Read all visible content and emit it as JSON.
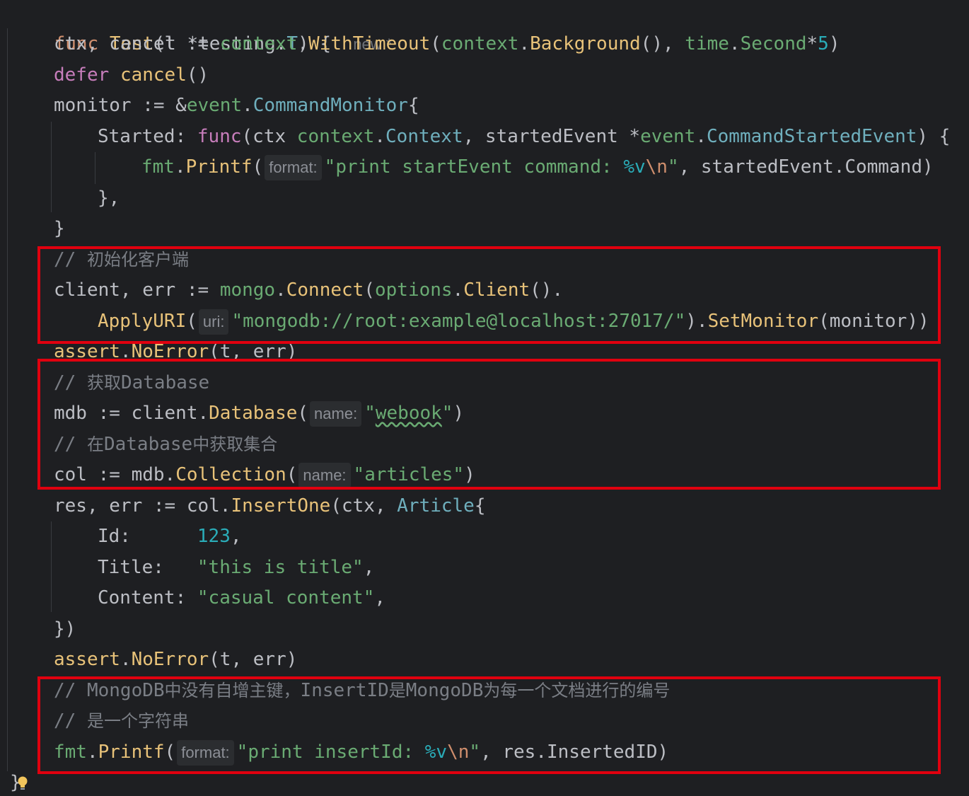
{
  "editor": {
    "language": "Go",
    "colors": {
      "background": "#1e1f22",
      "keyword": "#cf8e6d",
      "function": "#56a8f5",
      "string": "#6aab73",
      "comment": "#7a7e85",
      "highlight_box": "#e0000f"
    },
    "l1": {
      "kw": "func",
      "name": "Test",
      "p1": "(t *testing.",
      "p2": "T",
      "p3": ") {",
      "meta": "new *"
    },
    "l2": {
      "a": "ctx, cancel := ",
      "b": "context",
      "c": ".",
      "d": "WithTimeout",
      "e": "(",
      "f": "context",
      "g": ".",
      "h": "Background",
      "i": "(), ",
      "j": "time",
      "k": ".",
      "l": "Second",
      "m": "*",
      "n": "5",
      "o": ")"
    },
    "l3": {
      "kw": "defer",
      "call": "cancel",
      "rest": "()"
    },
    "l4": {
      "a": "monitor := &",
      "b": "event",
      "c": ".",
      "d": "CommandMonitor",
      "e": "{"
    },
    "l5": {
      "a": "Started: ",
      "kw": "func",
      "b": "(ctx ",
      "c": "context",
      "d": ".",
      "e": "Context",
      "f": ", startedEvent *",
      "g": "event",
      "h": ".",
      "i": "CommandStartedEvent",
      "j": ") {"
    },
    "l6": {
      "a": "fmt",
      "b": ".",
      "c": "Printf",
      "d": "(",
      "hint": "format:",
      "s1": "\"print startEvent command: ",
      "v": "%v",
      "n": "\\n",
      "s2": "\"",
      "e": ", startedEvent.Command)"
    },
    "l7": {
      "a": "},"
    },
    "l8": {
      "a": "}"
    },
    "l9": {
      "a": "// ",
      "cjk": "初始化客户端"
    },
    "l10": {
      "a": "client, err := ",
      "b": "mongo",
      "c": ".",
      "d": "Connect",
      "e": "(",
      "f": "options",
      "g": ".",
      "h": "Client",
      "i": "()."
    },
    "l11": {
      "a": "ApplyURI",
      "b": "(",
      "hint": "uri:",
      "s": "\"mongodb://root:example@localhost:27017/\"",
      "c": ").",
      "d": "SetMonitor",
      "e": "(monitor))"
    },
    "l12": {
      "a": "assert",
      "b": ".",
      "c": "NoError",
      "d": "(t, err)"
    },
    "l13": {
      "a": "// ",
      "cjk": "获取",
      "b": "Database"
    },
    "l14": {
      "a": "mdb := client.",
      "b": "Database",
      "c": "(",
      "hint": "name:",
      "s1": "\"",
      "sq": "webook",
      "s2": "\"",
      "d": ")"
    },
    "l15": {
      "a": "// ",
      "cjk1": "在",
      "b": "Database",
      "cjk2": "中获取集合"
    },
    "l16": {
      "a": "col := mdb.",
      "b": "Collection",
      "c": "(",
      "hint": "name:",
      "s": "\"articles\"",
      "d": ")"
    },
    "l17": {
      "a": "res, err := col.",
      "b": "InsertOne",
      "c": "(ctx, ",
      "d": "Article",
      "e": "{"
    },
    "l18": {
      "a": "Id:      ",
      "n": "123",
      "b": ","
    },
    "l19": {
      "a": "Title:   ",
      "s": "\"this is title\"",
      "b": ","
    },
    "l20": {
      "a": "Content: ",
      "s": "\"casual content\"",
      "b": ","
    },
    "l21": {
      "a": "})"
    },
    "l22": {
      "a": "assert",
      "b": ".",
      "c": "NoError",
      "d": "(t, err)"
    },
    "l23": {
      "a": "// MongoDB",
      "cjk1": "中没有自增主键，",
      "b": "InsertID",
      "cjk2": "是",
      "c": "MongoDB",
      "cjk3": "为每一个文档进行的编号"
    },
    "l24": {
      "a": "// ",
      "cjk": "是一个字符串"
    },
    "l25": {
      "a": "fmt",
      "b": ".",
      "c": "Printf",
      "d": "(",
      "hint": "format:",
      "s1": "\"print insertId: ",
      "v": "%v",
      "n": "\\n",
      "s2": "\"",
      "e": ", res.InsertedID)"
    },
    "l26": {
      "a": "}"
    },
    "gutter_icon": "lightbulb-icon"
  }
}
